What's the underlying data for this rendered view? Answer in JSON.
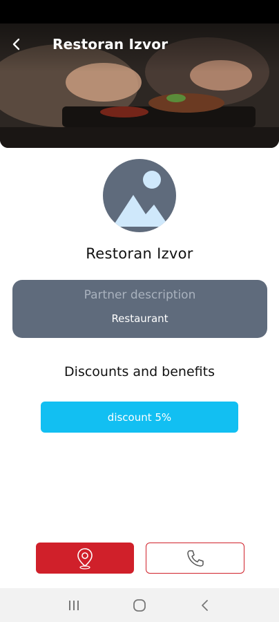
{
  "header": {
    "title": "Restoran Izvor",
    "back_icon": "chevron-left-icon"
  },
  "partner": {
    "name": "Restoran Izvor",
    "avatar_icon": "image-placeholder-icon"
  },
  "description": {
    "label": "Partner description",
    "value": "Restaurant"
  },
  "discounts": {
    "heading": "Discounts and benefits",
    "items": [
      {
        "label": "discount 5%"
      }
    ]
  },
  "actions": {
    "location_icon": "map-pin-icon",
    "call_icon": "phone-icon"
  },
  "system_nav": {
    "recents_icon": "recents-icon",
    "home_icon": "home-icon",
    "back_icon": "back-icon"
  },
  "colors": {
    "accent_red": "#d0202a",
    "discount_blue": "#12bff2",
    "card_slate": "#5f6b7c"
  }
}
